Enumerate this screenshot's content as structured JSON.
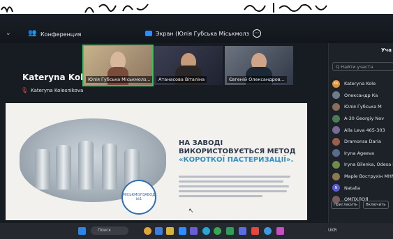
{
  "meeting": {
    "title": "Конференция",
    "screen_share_label": "Экран (Юлія Губська Міськмолз",
    "speaker_name": "Kateryna Koles...",
    "speaker_sub": "Kateryna Kolesnikova"
  },
  "thumbnails": [
    {
      "label": "Юлія Губська Міськмолз..."
    },
    {
      "label": "Атанасова Віталіна"
    },
    {
      "label": "Євгеній Олександров..."
    }
  ],
  "slide": {
    "heading": "НА ЗАВОДІ ВИКОРИСТОВУЄТЬСЯ МЕТОД",
    "heading_accent": "«КОРОТКОЇ ПАСТЕРИЗАЦІЇ».",
    "badge_text": "МІСЬКМОЛЗАВОД №1"
  },
  "panel": {
    "title": "Уча",
    "search_placeholder": "Q Найти участн",
    "participants": [
      {
        "initials": "KK",
        "name": "Kateryna Kole",
        "color": "#e0913a"
      },
      {
        "initials": "",
        "name": "Олександр Ка",
        "color": "#6f7b88"
      },
      {
        "initials": "",
        "name": "Юлія Губська М",
        "color": "#8a6d5b"
      },
      {
        "initials": "",
        "name": "A-30 Georgiy Nov",
        "color": "#4f7a5a"
      },
      {
        "initials": "",
        "name": "Alla Leva 465-303",
        "color": "#7b6a95"
      },
      {
        "initials": "",
        "name": "Dramonsa Daria",
        "color": "#9a5f4d"
      },
      {
        "initials": "",
        "name": "Iryna Ageeva",
        "color": "#596c8a"
      },
      {
        "initials": "",
        "name": "Iryna Bilenka, Odesa Na",
        "color": "#6e8a4d"
      },
      {
        "initials": "",
        "name": "Maple Вострухін МНМ1",
        "color": "#8a7a4d"
      },
      {
        "initials": "N",
        "name": "Natalia",
        "color": "#5b5bd6"
      },
      {
        "initials": "",
        "name": "ОМПХЛОЯ",
        "color": "#7a5d5d"
      }
    ],
    "btn_invite": "Пригласить",
    "btn_mute": "Включить"
  },
  "taskbar": {
    "search": "Поиск",
    "tray_text": "UKR"
  },
  "colors": {
    "accent": "#2d8ec9",
    "active_speaker": "#35c759",
    "mic_muted": "#e0463c"
  }
}
